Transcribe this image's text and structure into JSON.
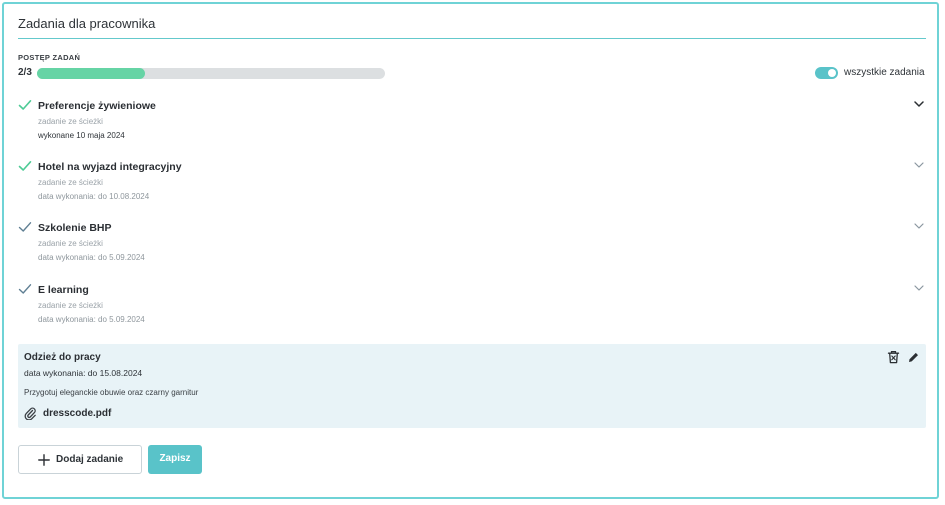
{
  "header": {
    "title": "Zadania dla pracownika"
  },
  "progress": {
    "label": "POSTĘP ZADAŃ",
    "count": "2/3",
    "fraction": 0.31,
    "fill_color": "#66d4a5"
  },
  "filter": {
    "label": "wszystkie zadania",
    "enabled": true,
    "accent": "#59c3c9"
  },
  "tasks": [
    {
      "name": "Preferencje żywieniowe",
      "source": "zadanie ze ścieżki",
      "date": "wykonane 10 maja 2024",
      "icon": "check-icon",
      "check_color": "#4ecb96"
    },
    {
      "name": "Hotel na wyjazd integracyjny",
      "source": "zadanie ze ścieżki",
      "date": "data wykonania: do 10.08.2024",
      "icon": "check-icon",
      "check_color": "#4ecb96"
    },
    {
      "name": "Szkolenie BHP",
      "source": "zadanie ze ścieżki",
      "date": "data wykonania: do 5.09.2024",
      "icon": "check-icon",
      "check_color": "#5f7f93"
    },
    {
      "name": "E learning",
      "source": "zadanie ze ścieżki",
      "date": "data wykonania: do 5.09.2024",
      "icon": "check-icon",
      "check_color": "#5f7f93"
    }
  ],
  "custom_task": {
    "title": "Odzież do pracy",
    "date": "data wykonania:  do 15.08.2024",
    "description": "Przygotuj eleganckie obuwie oraz czarny garnitur",
    "attachment": "dresscode.pdf",
    "icons": [
      "trash-icon",
      "pencil-icon",
      "paperclip-icon"
    ]
  },
  "actions": {
    "add_label": "Dodaj zadanie",
    "save_label": "Zapisz"
  }
}
